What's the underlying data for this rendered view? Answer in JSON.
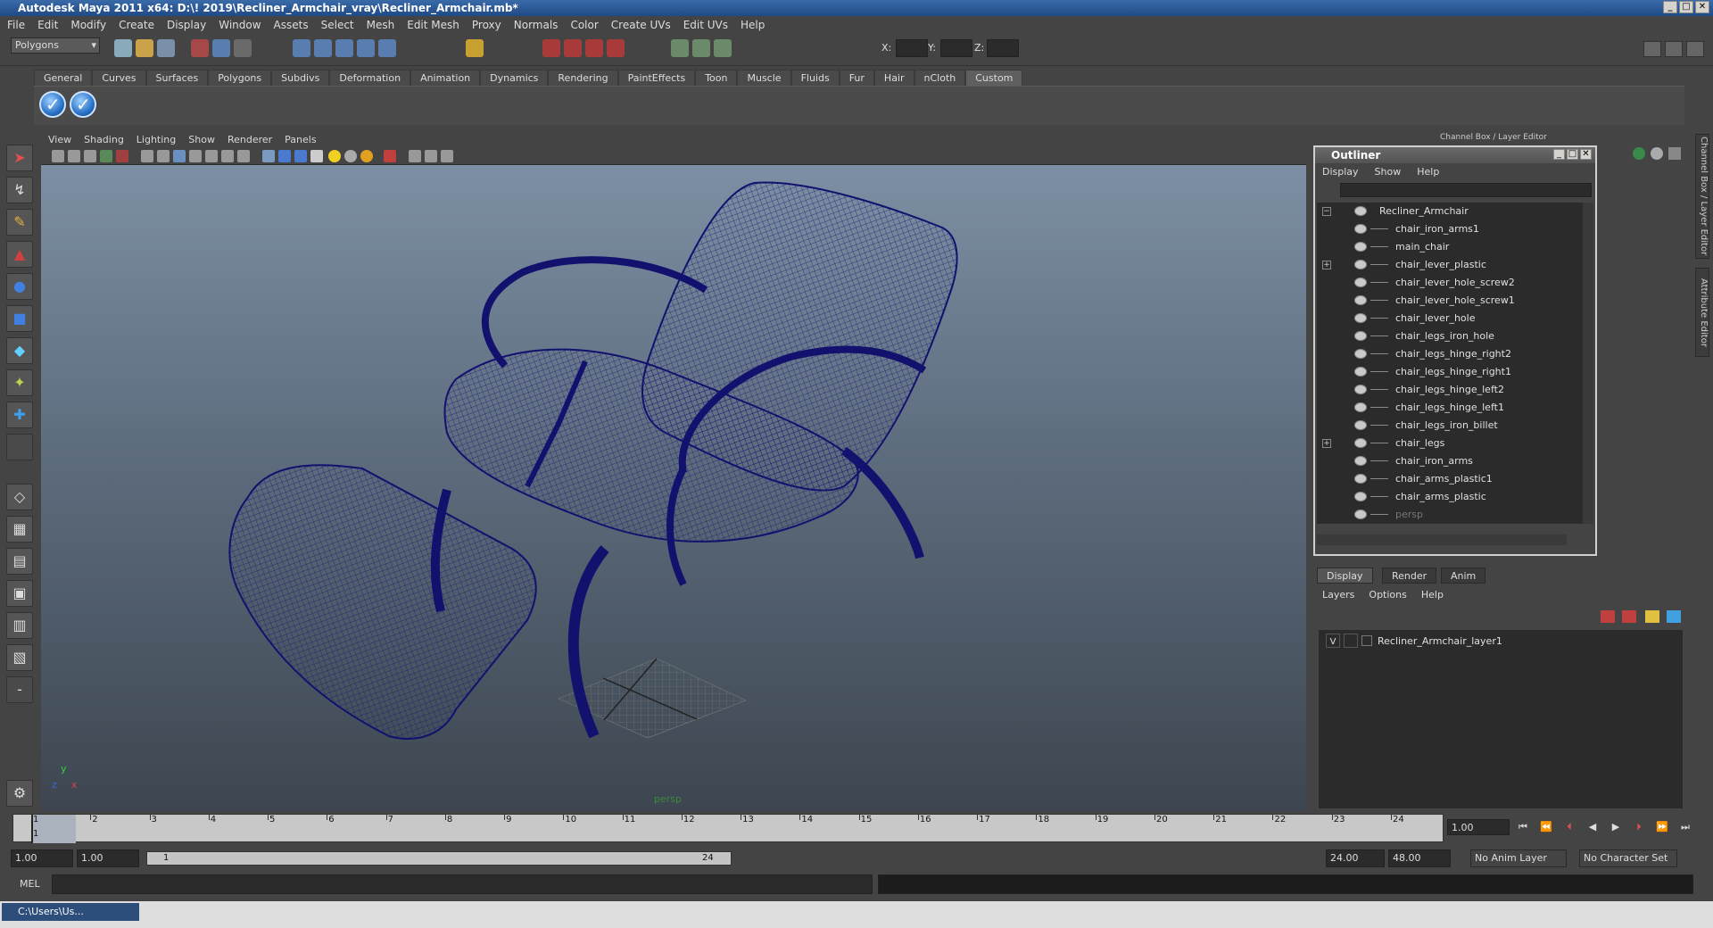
{
  "window": {
    "title": "Autodesk Maya 2011 x64: D:\\! 2019\\Recliner_Armchair_vray\\Recliner_Armchair.mb*"
  },
  "menubar": [
    "File",
    "Edit",
    "Modify",
    "Create",
    "Display",
    "Window",
    "Assets",
    "Select",
    "Mesh",
    "Edit Mesh",
    "Proxy",
    "Normals",
    "Color",
    "Create UVs",
    "Edit UVs",
    "Help"
  ],
  "status": {
    "mode": "Polygons",
    "x_label": "X:",
    "y_label": "Y:",
    "z_label": "Z:"
  },
  "shelf": {
    "tabs": [
      "General",
      "Curves",
      "Surfaces",
      "Polygons",
      "Subdivs",
      "Deformation",
      "Animation",
      "Dynamics",
      "Rendering",
      "PaintEffects",
      "Toon",
      "Muscle",
      "Fluids",
      "Fur",
      "Hair",
      "nCloth",
      "Custom"
    ],
    "active": "Custom"
  },
  "viewport": {
    "menu": [
      "View",
      "Shading",
      "Lighting",
      "Show",
      "Renderer",
      "Panels"
    ],
    "camera": "persp",
    "axis_x": "x",
    "axis_y": "y",
    "axis_z": "z"
  },
  "panel_title": "Channel Box / Layer Editor",
  "outliner": {
    "title": "Outliner",
    "menu": [
      "Display",
      "Show",
      "Help"
    ],
    "items": [
      {
        "label": "Recliner_Armchair",
        "root": true,
        "exp": "−"
      },
      {
        "label": "chair_iron_arms1"
      },
      {
        "label": "main_chair"
      },
      {
        "label": "chair_lever_plastic",
        "exp": "+"
      },
      {
        "label": "chair_lever_hole_screw2"
      },
      {
        "label": "chair_lever_hole_screw1"
      },
      {
        "label": "chair_lever_hole"
      },
      {
        "label": "chair_legs_iron_hole"
      },
      {
        "label": "chair_legs_hinge_right2"
      },
      {
        "label": "chair_legs_hinge_right1"
      },
      {
        "label": "chair_legs_hinge_left2"
      },
      {
        "label": "chair_legs_hinge_left1"
      },
      {
        "label": "chair_legs_iron_billet"
      },
      {
        "label": "chair_legs",
        "exp": "+"
      },
      {
        "label": "chair_iron_arms"
      },
      {
        "label": "chair_arms_plastic1"
      },
      {
        "label": "chair_arms_plastic"
      },
      {
        "label": "persp",
        "dim": true
      }
    ]
  },
  "layer_editor": {
    "tabs": [
      "Display",
      "Render",
      "Anim"
    ],
    "menu": [
      "Layers",
      "Options",
      "Help"
    ],
    "layer": {
      "visible": "V",
      "name": "Recliner_Armchair_layer1"
    }
  },
  "side_tabs": [
    "Channel Box / Layer Editor",
    "Attribute Editor"
  ],
  "timeline": {
    "ticks": [
      "1",
      "2",
      "3",
      "4",
      "5",
      "6",
      "7",
      "8",
      "9",
      "10",
      "11",
      "12",
      "13",
      "14",
      "15",
      "16",
      "17",
      "18",
      "19",
      "20",
      "21",
      "22",
      "23",
      "24"
    ],
    "current_marker": "1",
    "current_frame": "1.00"
  },
  "range": {
    "start": "1.00",
    "start2": "1.00",
    "slider_start": "1",
    "slider_end": "24",
    "end": "24.00",
    "end2": "48.00",
    "anim_layer": "No Anim Layer",
    "char_set": "No Character Set"
  },
  "mel": {
    "label": "MEL"
  },
  "taskbar": {
    "item": "C:\\Users\\Us..."
  }
}
